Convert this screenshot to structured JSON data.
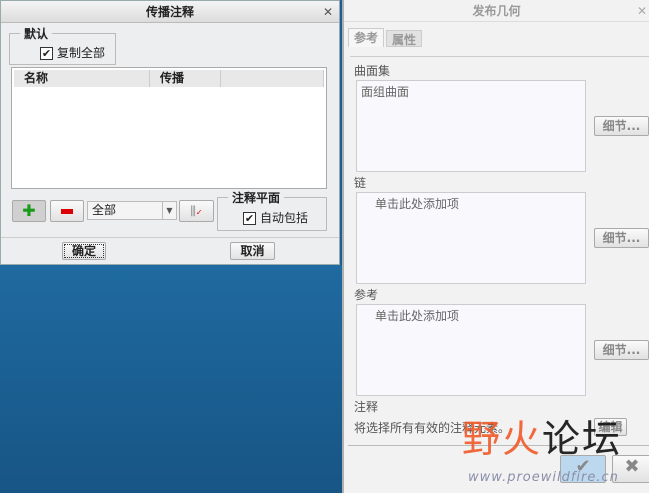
{
  "dialog": {
    "title": "传播注释",
    "default_group": "默认",
    "copy_all": "复制全部",
    "columns": [
      "名称",
      "传播"
    ],
    "filter_value": "全部",
    "plane_group": "注释平面",
    "auto_include": "自动包括",
    "ok": "确定",
    "cancel": "取消",
    "close": "✕"
  },
  "panel": {
    "title": "发布几何",
    "close": "✕",
    "tabs": [
      "参考",
      "属性"
    ],
    "surface_set_label": "曲面集",
    "surface_set_value": "面组曲面",
    "chain_label": "链",
    "chain_placeholder": "单击此处添加项",
    "ref_label": "参考",
    "ref_placeholder": "单击此处添加项",
    "details": "细节...",
    "note_label": "注释",
    "note_text": "将选择所有有效的注释元素。",
    "edit": "编辑"
  },
  "watermark": {
    "title": "野火论坛",
    "url": "www.proewildfire.cn"
  }
}
